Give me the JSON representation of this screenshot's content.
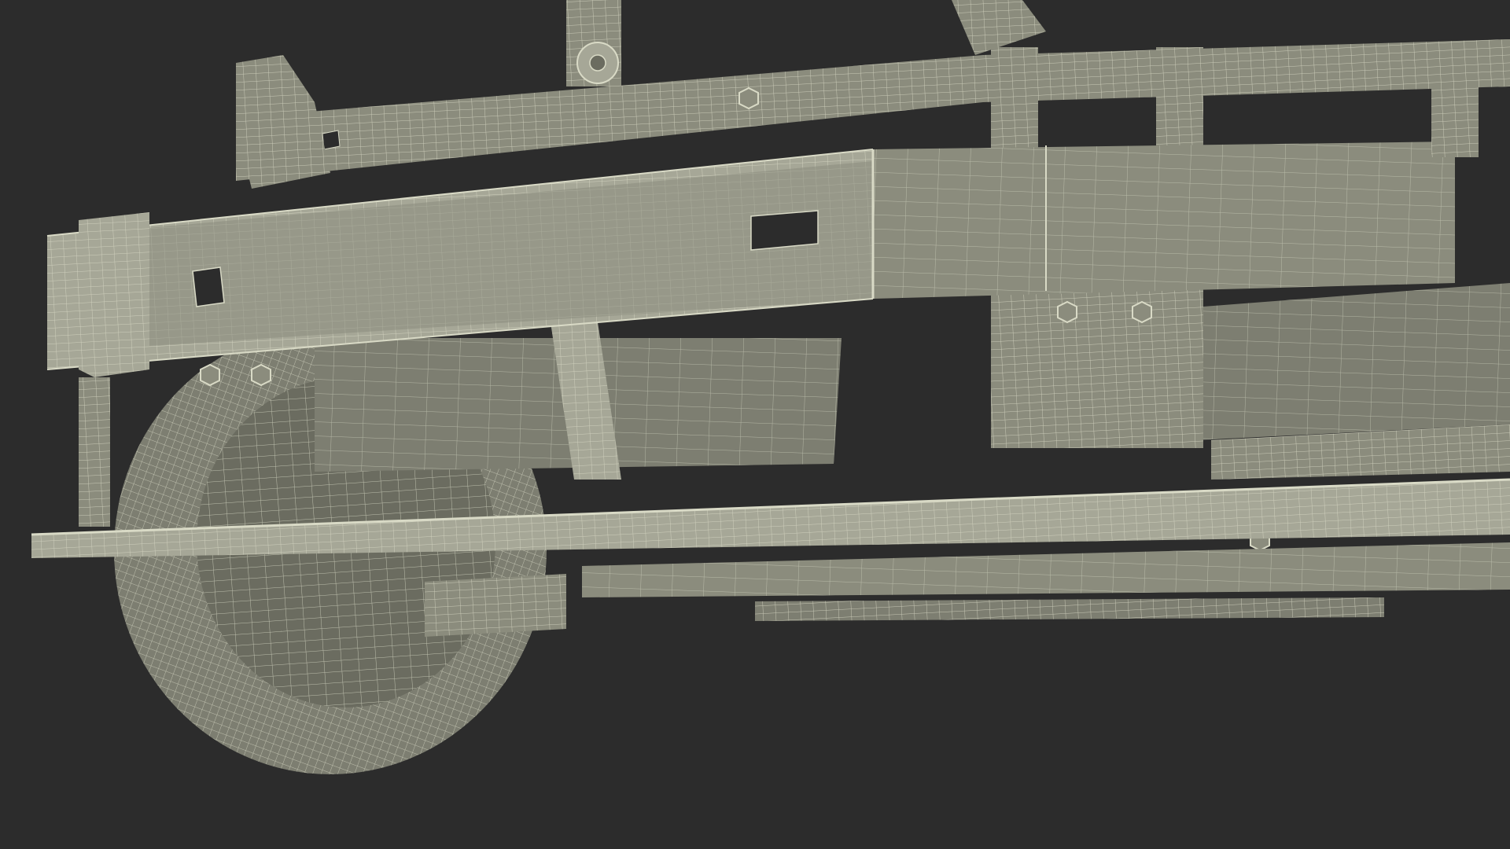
{
  "scene": {
    "subject": "chassis-wireframe-render",
    "colors": {
      "background": "#2c2c2c",
      "surface": "#8b8c7d",
      "surface_light": "#a6a797",
      "surface_dark": "#6b6c60",
      "wire": "#d9dac6",
      "wire_soft": "#c4c5b1",
      "hole": "#2c2c2c"
    }
  }
}
